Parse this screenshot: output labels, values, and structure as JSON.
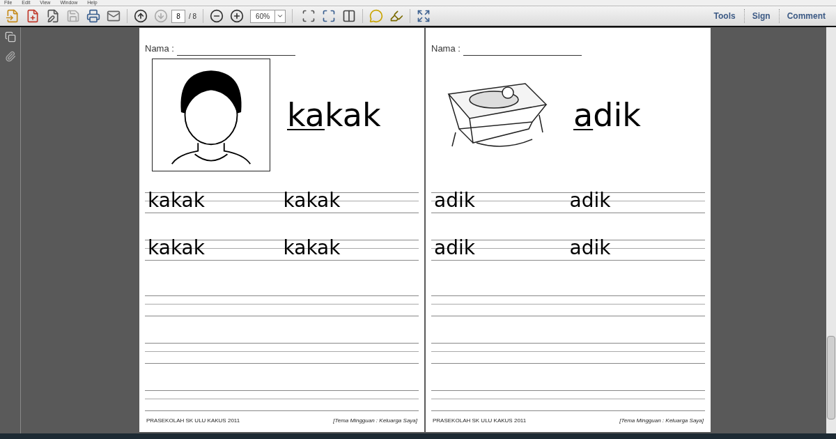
{
  "menu": [
    "File",
    "Edit",
    "View",
    "Window",
    "Help"
  ],
  "toolbar": {
    "page_number": "8",
    "page_total": "/ 8",
    "zoom": "60%",
    "panels": [
      "Tools",
      "Sign",
      "Comment"
    ]
  },
  "pages": [
    {
      "name_label": "Nama :",
      "picture": {
        "kind": "girl",
        "framed": true
      },
      "word": [
        {
          "text": "ka",
          "underlined": true
        },
        {
          "text": "kak",
          "underlined": false
        }
      ],
      "practice_rows": [
        [
          "kakak",
          "kakak"
        ],
        [
          "kakak",
          "kakak"
        ]
      ],
      "footer_left": "PRASEKOLAH SK ULU KAKUS 2011",
      "footer_right": "[Tema Mingguan : Keluarga Saya]"
    },
    {
      "name_label": "Nama :",
      "picture": {
        "kind": "cradle",
        "framed": false
      },
      "word": [
        {
          "text": "a",
          "underlined": true
        },
        {
          "text": "dik",
          "underlined": false
        }
      ],
      "practice_rows": [
        [
          "adik",
          "adik"
        ],
        [
          "adik",
          "adik"
        ]
      ],
      "footer_left": "PRASEKOLAH SK ULU KAKUS 2011",
      "footer_right": "[Tema Mingguan : Keluarga Saya]"
    }
  ]
}
